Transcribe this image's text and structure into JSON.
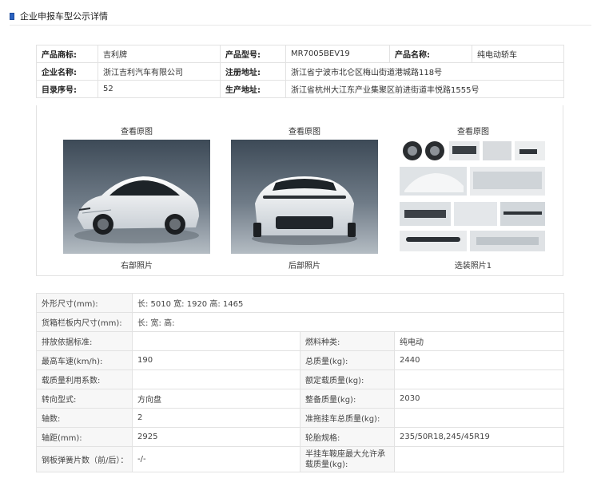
{
  "page": {
    "title": "企业申报车型公示详情"
  },
  "basic": {
    "brand_label": "产品商标:",
    "brand": "吉利牌",
    "model_label": "产品型号:",
    "model": "MR7005BEV19",
    "name_label": "产品名称:",
    "name": "纯电动轿车",
    "company_label": "企业名称:",
    "company": "浙江吉利汽车有限公司",
    "reg_addr_label": "注册地址:",
    "reg_addr": "浙江省宁波市北仑区梅山街道港城路118号",
    "catalog_label": "目录序号:",
    "catalog": "52",
    "prod_addr_label": "生产地址:",
    "prod_addr": "浙江省杭州大江东产业集聚区前进街道丰悦路1555号"
  },
  "photos": [
    {
      "link": "查看原图",
      "caption": "右部照片"
    },
    {
      "link": "查看原图",
      "caption": "后部照片"
    },
    {
      "link": "查看原图",
      "caption": "选装照片1"
    }
  ],
  "specs": {
    "dims_label": "外形尺寸(mm):",
    "dims": "长: 5010 宽: 1920 高: 1465",
    "cargo_label": "货箱栏板内尺寸(mm):",
    "cargo": "长:  宽:  高:",
    "emission_label": "排放依据标准:",
    "emission": "",
    "fuel_label": "燃料种类:",
    "fuel": "纯电动",
    "speed_label": "最高车速(km/h):",
    "speed": "190",
    "total_mass_label": "总质量(kg):",
    "total_mass": "2440",
    "load_coef_label": "载质量利用系数:",
    "load_coef": "",
    "rated_load_label": "额定载质量(kg):",
    "rated_load": "",
    "steering_label": "转向型式:",
    "steering": "方向盘",
    "curb_label": "整备质量(kg):",
    "curb": "2030",
    "axles_label": "轴数:",
    "axles": "2",
    "trailer_label": "准拖挂车总质量(kg):",
    "trailer": "",
    "wheelbase_label": "轴距(mm):",
    "wheelbase": "2925",
    "tire_label": "轮胎规格:",
    "tire": "235/50R18,245/45R19",
    "spring_label": "钢板弹簧片数（前/后）：",
    "spring": "-/-",
    "saddle_label": "半挂车鞍座最大允许承载质量(kg):",
    "saddle": ""
  }
}
